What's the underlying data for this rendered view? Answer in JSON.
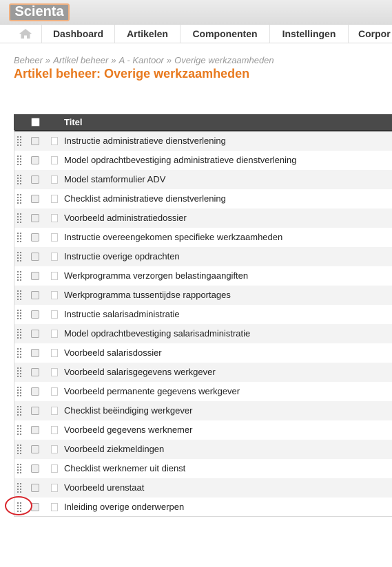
{
  "app": {
    "logo_text": "Scienta"
  },
  "nav": {
    "home_icon": "home-icon",
    "items": [
      {
        "label": "Dashboard"
      },
      {
        "label": "Artikelen"
      },
      {
        "label": "Componenten"
      },
      {
        "label": "Instellingen"
      },
      {
        "label": "Corpor"
      }
    ]
  },
  "breadcrumb": [
    "Beheer",
    "Artikel beheer",
    "A - Kantoor",
    "Overige werkzaamheden"
  ],
  "breadcrumb_separator": "»",
  "page_title": "Artikel beheer: Overige werkzaamheden",
  "table": {
    "column_title": "Titel",
    "rows": [
      "Instructie administratieve dienstverlening",
      "Model opdrachtbevestiging administratieve dienstverlening",
      "Model stamformulier ADV",
      "Checklist administratieve dienstverlening",
      "Voorbeeld administratiedossier",
      "Instructie overeengekomen specifieke werkzaamheden",
      "Instructie overige opdrachten",
      "Werkprogramma verzorgen belastingaangiften",
      "Werkprogramma tussentijdse rapportages",
      "Instructie salarisadministratie",
      "Model opdrachtbevestiging salarisadministratie",
      "Voorbeeld salarisdossier",
      "Voorbeeld salarisgegevens werkgever",
      "Voorbeeld permanente gegevens werkgever",
      "Checklist beëindiging werkgever",
      "Voorbeeld gegevens werknemer",
      "Voorbeeld ziekmeldingen",
      "Checklist werknemer uit dienst",
      "Voorbeeld urenstaat",
      "Inleiding overige onderwerpen"
    ]
  },
  "colors": {
    "accent": "#e87a1f",
    "header_bg": "#4a4a4a",
    "annotation": "#d8232a"
  }
}
